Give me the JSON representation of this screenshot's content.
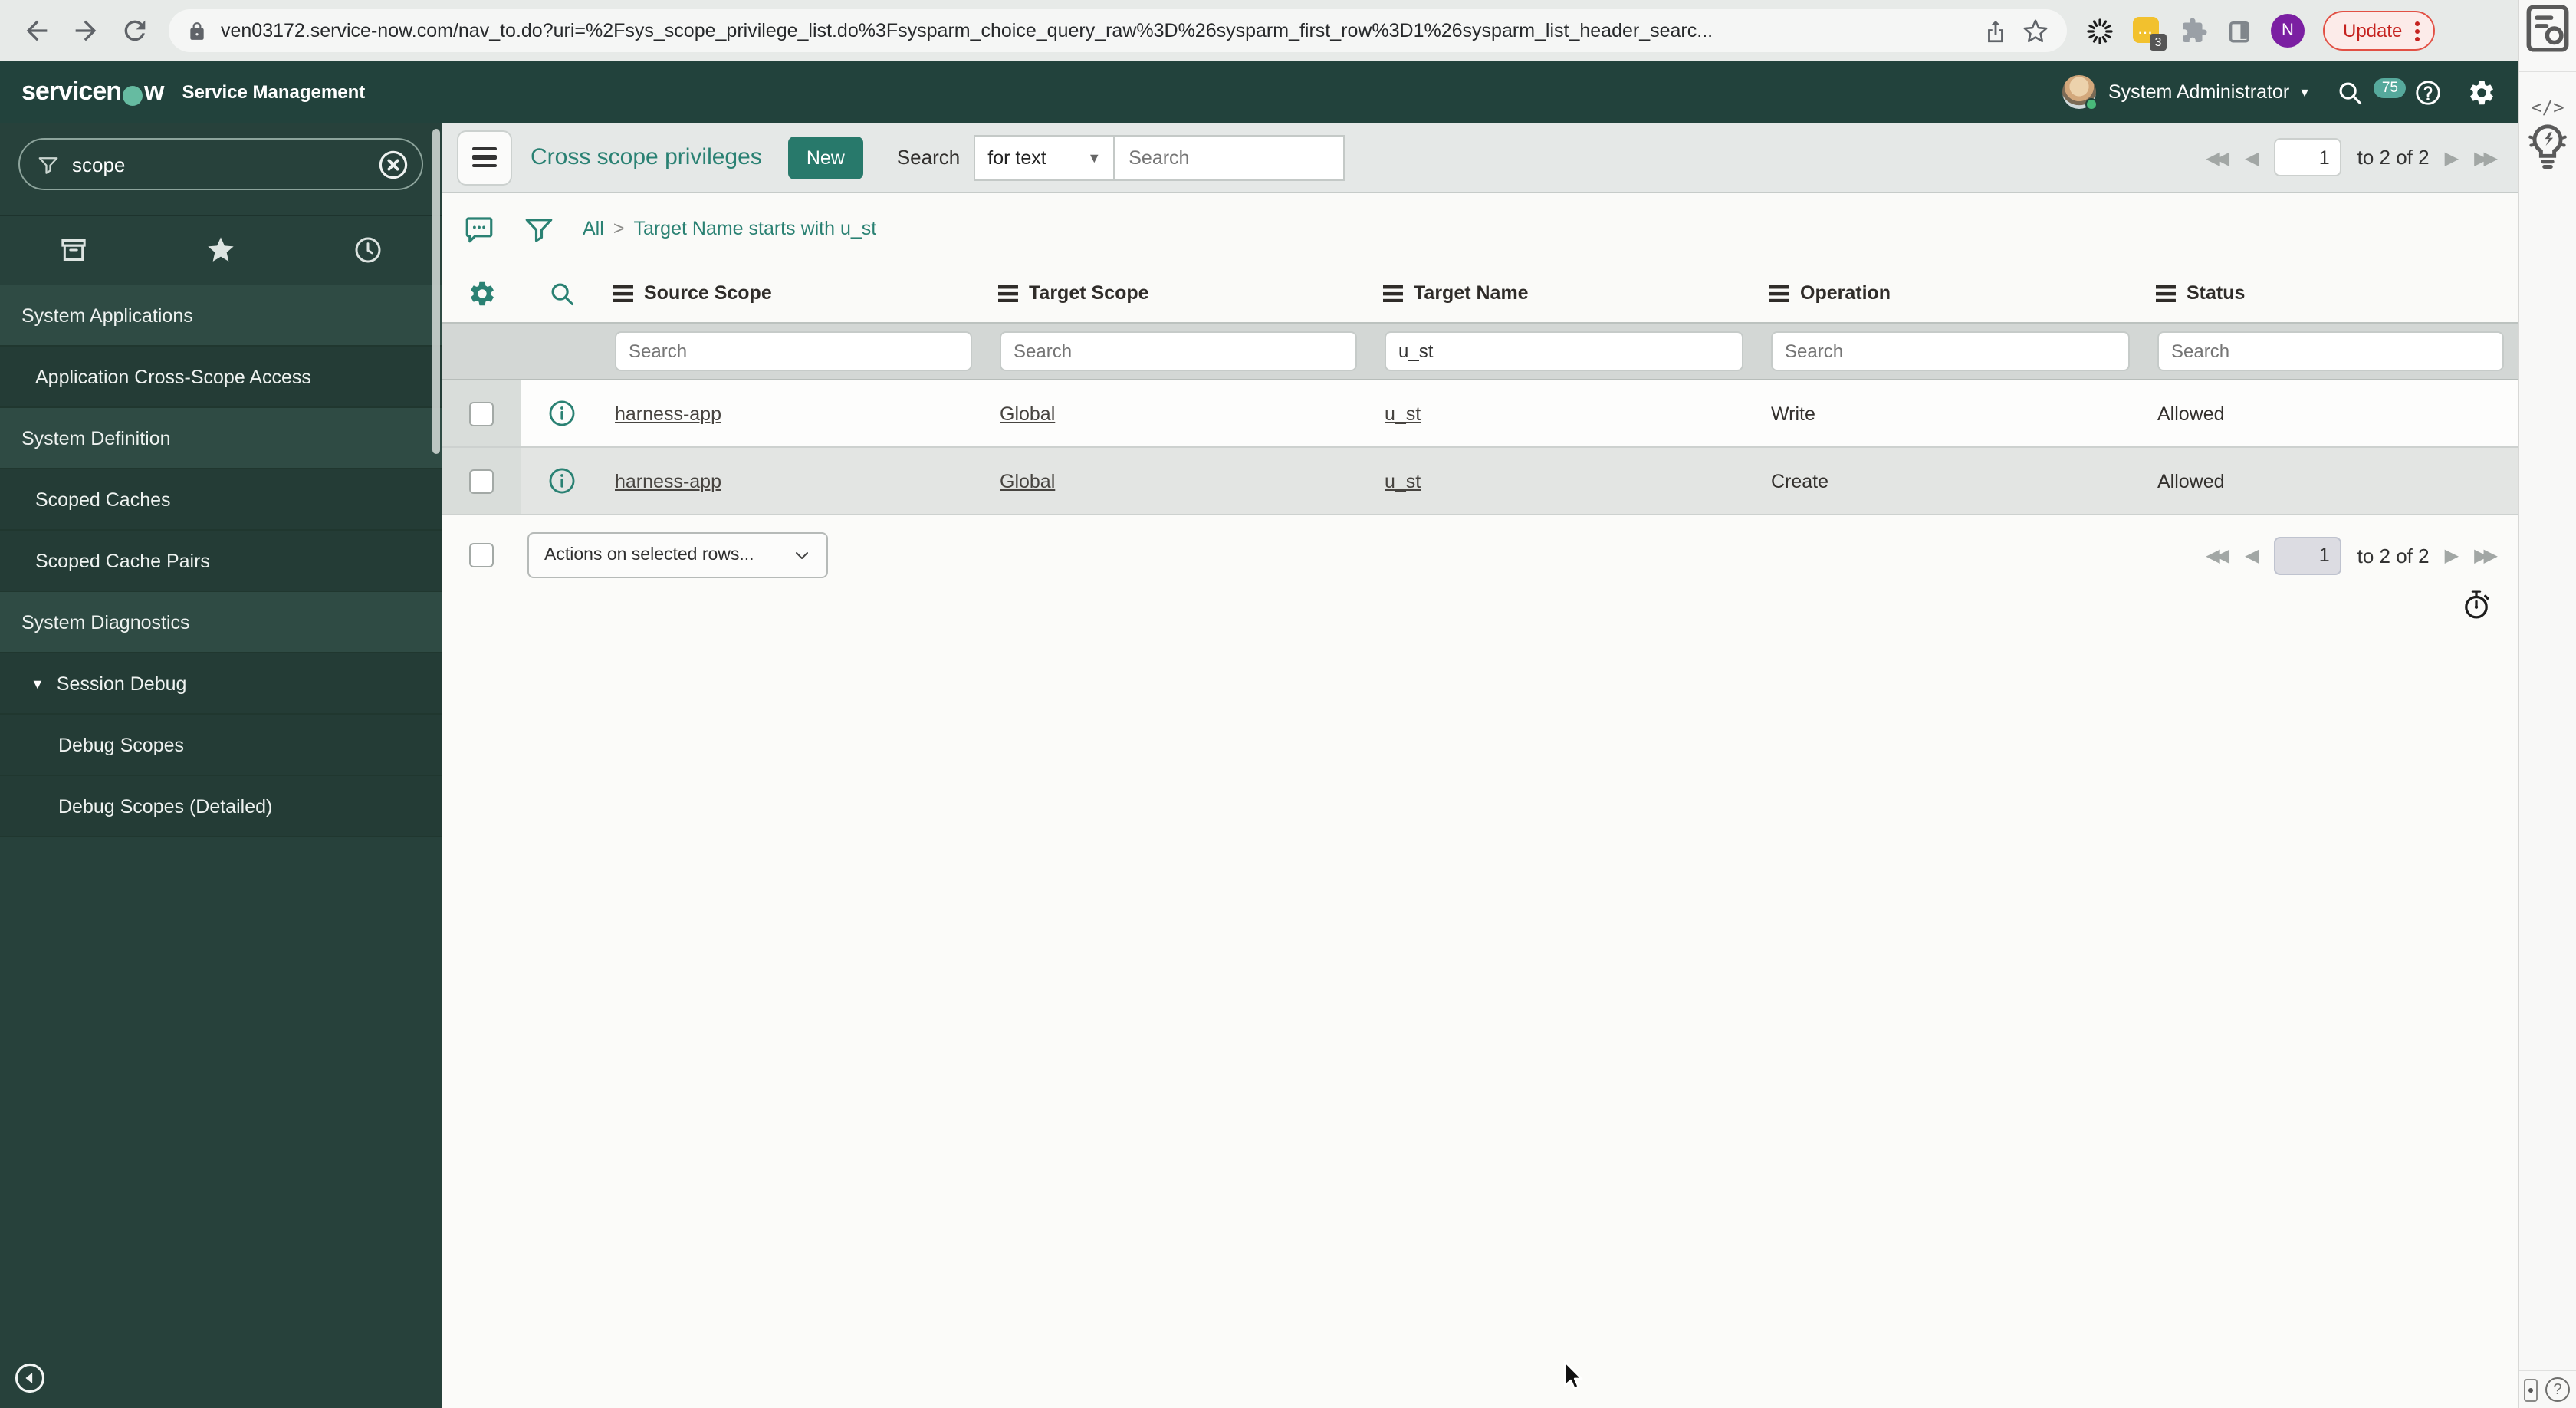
{
  "browser": {
    "url": "ven03172.service-now.com/nav_to.do?uri=%2Fsys_scope_privilege_list.do%3Fsysparm_choice_query_raw%3D%26sysparm_first_row%3D1%26sysparm_list_header_searc...",
    "extension_badge": "3",
    "extension_dots": "...",
    "profile_initial": "N",
    "update_label": "Update"
  },
  "app_header": {
    "logo_pre": "servicen",
    "logo_o": "o",
    "logo_post": "w",
    "product": "Service Management",
    "user_name": "System Administrator",
    "chat_badge": "75"
  },
  "sidebar": {
    "filter_value": "scope",
    "items": [
      {
        "label": "System Applications",
        "type": "header"
      },
      {
        "label": "Application Cross-Scope Access",
        "type": "child"
      },
      {
        "label": "System Definition",
        "type": "header"
      },
      {
        "label": "Scoped Caches",
        "type": "child"
      },
      {
        "label": "Scoped Cache Pairs",
        "type": "child"
      },
      {
        "label": "System Diagnostics",
        "type": "header"
      },
      {
        "label": "Session Debug",
        "type": "expanded"
      },
      {
        "label": "Debug Scopes",
        "type": "grandchild"
      },
      {
        "label": "Debug Scopes (Detailed)",
        "type": "grandchild"
      }
    ]
  },
  "toolbar": {
    "title": "Cross scope privileges",
    "new_label": "New",
    "search_label": "Search",
    "search_type_value": "for text",
    "search_placeholder": "Search"
  },
  "breadcrumb": {
    "root": "All",
    "separator": ">",
    "current": "Target Name starts with u_st"
  },
  "pagination": {
    "page_value": "1",
    "range_label": "to 2 of 2"
  },
  "list": {
    "columns": [
      "Source Scope",
      "Target Scope",
      "Target Name",
      "Operation",
      "Status"
    ],
    "filter_placeholder": "Search",
    "target_name_filter": "u_st",
    "rows": [
      {
        "source_scope": "harness-app",
        "target_scope": "Global",
        "target_name": "u_st",
        "operation": "Write",
        "status": "Allowed"
      },
      {
        "source_scope": "harness-app",
        "target_scope": "Global",
        "target_name": "u_st",
        "operation": "Create",
        "status": "Allowed"
      }
    ],
    "actions_placeholder": "Actions on selected rows..."
  },
  "right_rail": {
    "code_glyph": "</>",
    "help_glyph": "?"
  },
  "icons": {
    "caret_down": "▼",
    "first": "◀◀",
    "prev": "◀",
    "next": "▶",
    "last": "▶▶"
  },
  "colors": {
    "header_bg": "#22423c",
    "sidebar_bg": "#27413b",
    "accent_teal": "#2a8173",
    "button_teal": "#28796b",
    "update_red": "#c5221f",
    "chat_badge_teal": "#56a99c"
  }
}
